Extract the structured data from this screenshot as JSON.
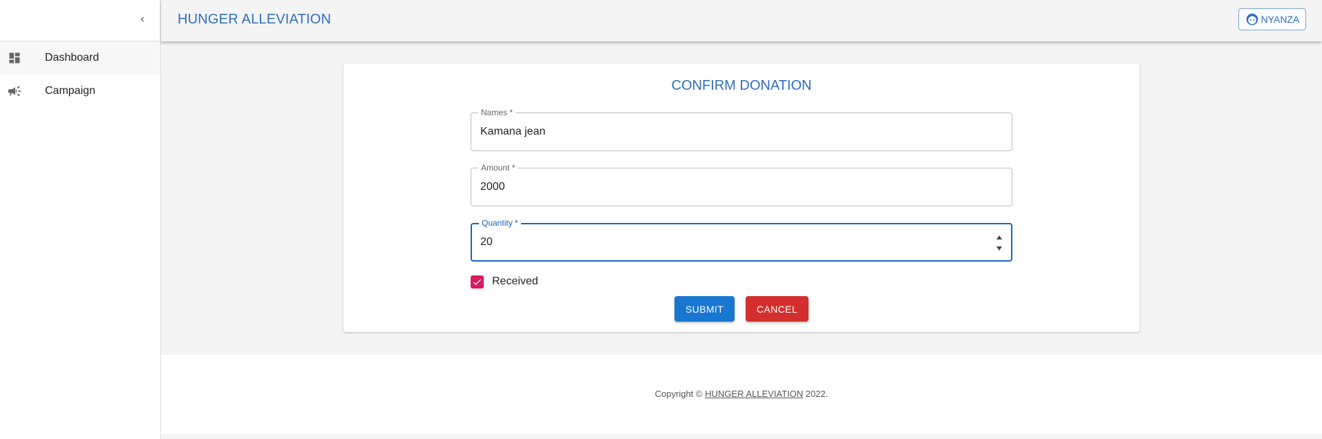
{
  "app": {
    "title": "HUNGER ALLEVIATION"
  },
  "sidebar": {
    "collapse_icon": "chevron-left-icon",
    "items": [
      {
        "label": "Dashboard",
        "icon": "dashboard-icon"
      },
      {
        "label": "Campaign",
        "icon": "campaign-icon"
      }
    ]
  },
  "user": {
    "label": "NYANZA",
    "icon": "face-icon"
  },
  "form": {
    "title": "CONFIRM DONATION",
    "names": {
      "label": "Names *",
      "value": "Kamana jean"
    },
    "amount": {
      "label": "Amount *",
      "value": "2000"
    },
    "quantity": {
      "label": "Quantity *",
      "value": "20"
    },
    "received": {
      "label": "Received",
      "checked": true
    },
    "submit_label": "SUBMIT",
    "cancel_label": "CANCEL"
  },
  "footer": {
    "prefix": "Copyright © ",
    "link": "HUNGER ALLEVIATION",
    "suffix": " 2022."
  },
  "colors": {
    "primary": "#1976d2",
    "title_blue": "#2f6fbf",
    "danger": "#d32f2f",
    "checkbox": "#d81b60"
  }
}
